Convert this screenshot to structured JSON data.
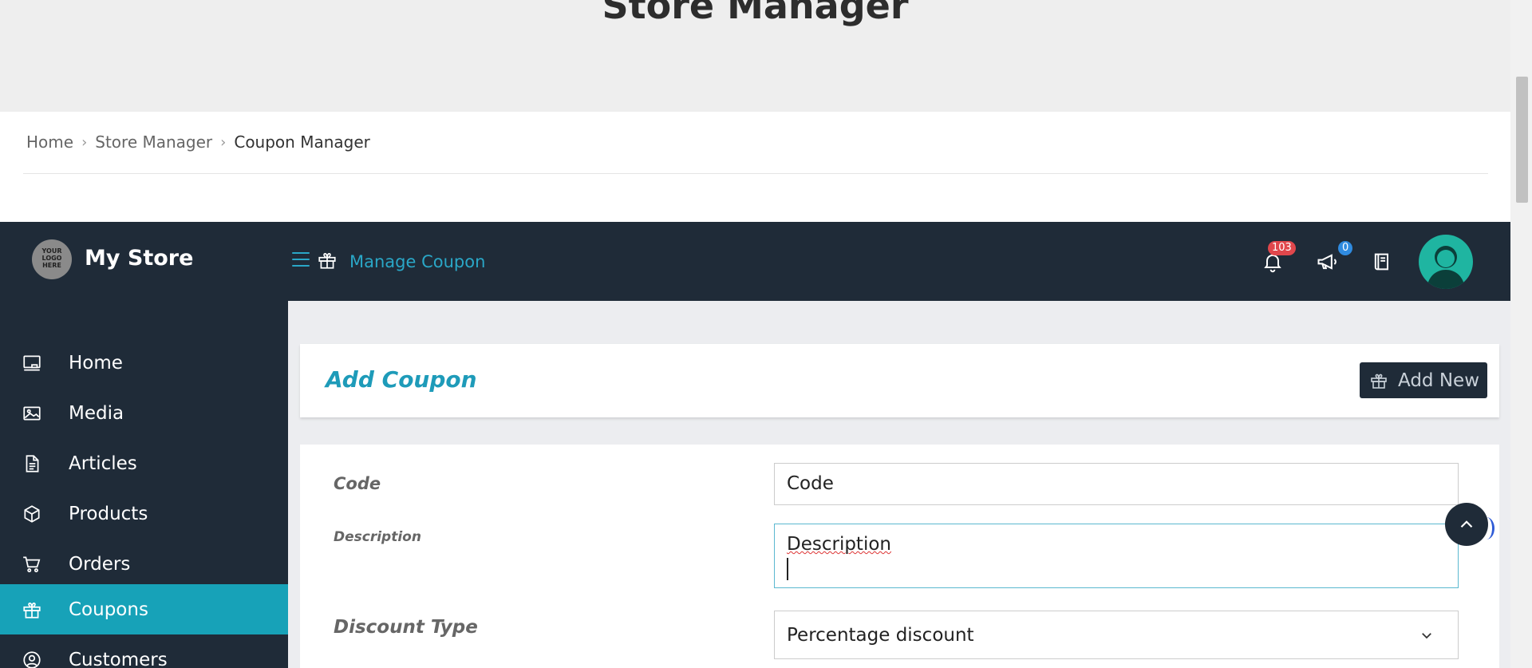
{
  "page": {
    "title": "Store Manager"
  },
  "breadcrumb": {
    "items": [
      "Home",
      "Store Manager",
      "Coupon Manager"
    ]
  },
  "topbar": {
    "logo_text": "YOUR LOGO HERE",
    "store_name": "My Store",
    "section_title": "Manage Coupon",
    "notifications_count": "103",
    "announcements_count": "0"
  },
  "sidebar": {
    "items": [
      {
        "label": "Home",
        "icon": "monitor-icon"
      },
      {
        "label": "Media",
        "icon": "image-icon"
      },
      {
        "label": "Articles",
        "icon": "document-icon"
      },
      {
        "label": "Products",
        "icon": "box-icon"
      },
      {
        "label": "Orders",
        "icon": "cart-icon"
      },
      {
        "label": "Coupons",
        "icon": "gift-icon",
        "active": true
      },
      {
        "label": "Customers",
        "icon": "user-circle-icon"
      }
    ]
  },
  "main": {
    "heading": "Add Coupon",
    "add_new_label": "Add New",
    "form": {
      "code_label": "Code",
      "code_value": "Code",
      "description_label": "Description",
      "description_value": "Description",
      "discount_type_label": "Discount Type",
      "discount_type_value": "Percentage discount"
    }
  },
  "colors": {
    "dark_navy": "#1f2b38",
    "accent": "#17a2b8",
    "badge_red": "#e0474c",
    "badge_blue": "#2f8be0"
  }
}
